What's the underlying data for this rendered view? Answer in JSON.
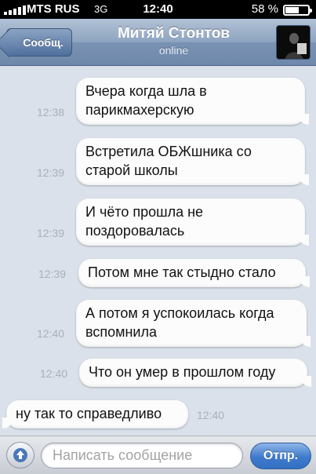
{
  "status_bar": {
    "carrier": "MTS RUS",
    "network": "3G",
    "time": "12:40",
    "battery_percent": "58 %",
    "battery_level": 0.58
  },
  "nav": {
    "back_label": "Сообщ.",
    "contact_name": "Митяй Стонтов",
    "status": "online"
  },
  "messages": [
    {
      "direction": "outgoing",
      "text": "Вчера когда шла в\nпарикмахерскую",
      "time": "12:38"
    },
    {
      "direction": "outgoing",
      "text": "Встретила ОБЖшника со\nстарой школы",
      "time": "12:39"
    },
    {
      "direction": "outgoing",
      "text": "И чёто прошла не\nпоздоровалась",
      "time": "12:39"
    },
    {
      "direction": "outgoing",
      "text": "Потом мне так стыдно стало",
      "time": "12:39"
    },
    {
      "direction": "outgoing",
      "text": "А потом я успокоилась когда\nвспомнила",
      "time": "12:40"
    },
    {
      "direction": "outgoing",
      "text": "Что он умер в прошлом году",
      "time": "12:40"
    },
    {
      "direction": "incoming",
      "text": "ну так то справедливо",
      "time": "12:40"
    }
  ],
  "input": {
    "placeholder": "Написать сообщение",
    "send_label": "Отпр.",
    "attach_icon": "arrow-up-icon"
  },
  "colors": {
    "background": "#dbe1ea",
    "bubble": "#fcfcfc",
    "timestamp": "#a8b0bb",
    "send_button": "#3f7acb"
  }
}
